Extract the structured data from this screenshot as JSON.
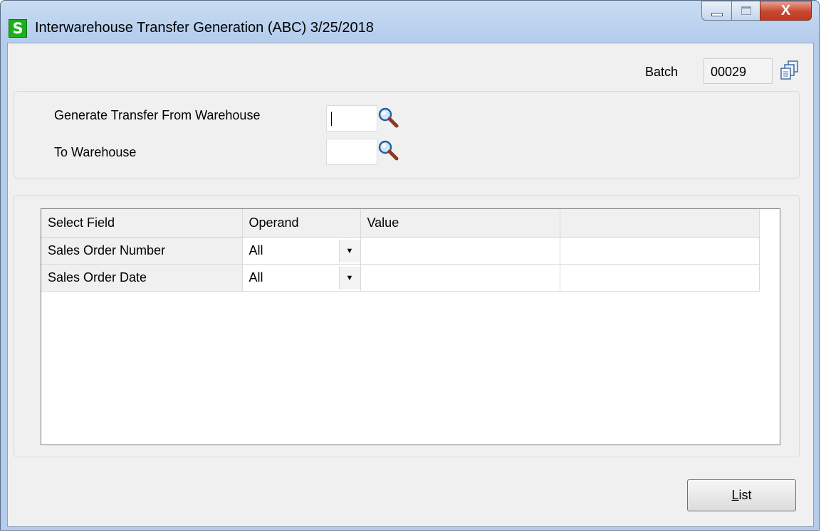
{
  "window": {
    "app_icon_letter": "S",
    "title": "Interwarehouse Transfer Generation (ABC) 3/25/2018",
    "close_glyph": "X"
  },
  "batch": {
    "label": "Batch",
    "value": "00029",
    "icon": "copy-batch-icon"
  },
  "warehouse": {
    "from_label": "Generate Transfer From Warehouse",
    "from_value": "",
    "to_label": "To Warehouse",
    "to_value": ""
  },
  "grid": {
    "columns": [
      "Select Field",
      "Operand",
      "Value",
      ""
    ],
    "rows": [
      {
        "field": "Sales Order Number",
        "operand": "All",
        "value": ""
      },
      {
        "field": "Sales Order Date",
        "operand": "All",
        "value": ""
      }
    ],
    "dropdown_glyph": "▼"
  },
  "buttons": {
    "list_first": "L",
    "list_rest": "ist"
  },
  "colors": {
    "app_icon": "#1ab01a",
    "close_button": "#c8472f",
    "title_gradient": "#b9d1ee"
  }
}
